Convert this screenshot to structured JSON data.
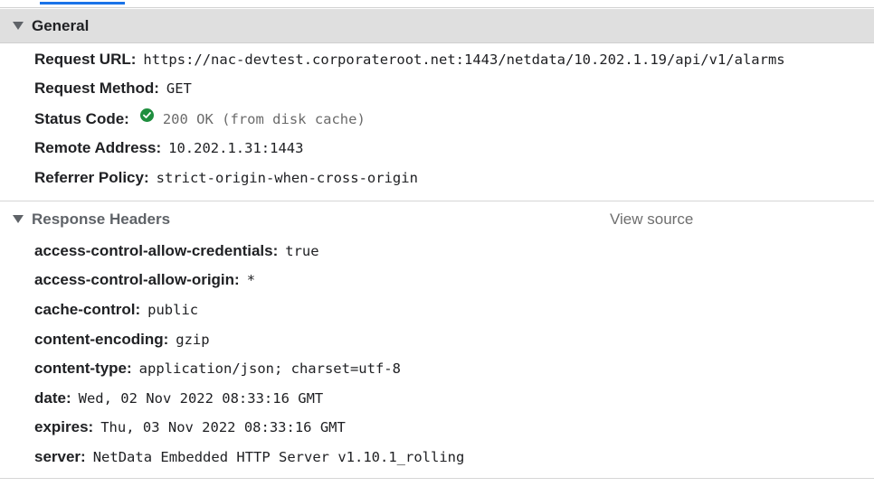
{
  "general": {
    "title": "General",
    "rows": [
      {
        "name": "Request URL:",
        "value": "https://nac-devtest.corporateroot.net:1443/netdata/10.202.1.19/api/v1/alarms"
      },
      {
        "name": "Request Method:",
        "value": "GET"
      },
      {
        "name": "Status Code:",
        "value": "200 OK (from disk cache)"
      },
      {
        "name": "Remote Address:",
        "value": "10.202.1.31:1443"
      },
      {
        "name": "Referrer Policy:",
        "value": "strict-origin-when-cross-origin"
      }
    ]
  },
  "response_headers": {
    "title": "Response Headers",
    "view_source_label": "View source",
    "rows": [
      {
        "name": "access-control-allow-credentials:",
        "value": "true"
      },
      {
        "name": "access-control-allow-origin:",
        "value": "*"
      },
      {
        "name": "cache-control:",
        "value": "public"
      },
      {
        "name": "content-encoding:",
        "value": "gzip"
      },
      {
        "name": "content-type:",
        "value": "application/json; charset=utf-8"
      },
      {
        "name": "date:",
        "value": "Wed, 02 Nov 2022 08:33:16 GMT"
      },
      {
        "name": "expires:",
        "value": "Thu, 03 Nov 2022 08:33:16 GMT"
      },
      {
        "name": "server:",
        "value": "NetData Embedded HTTP Server v1.10.1_rolling"
      }
    ]
  },
  "icons": {
    "section_toggle": "triangle-down-icon",
    "status": "check-circle-icon"
  },
  "colors": {
    "accent": "#1a73e8",
    "status_ok": "#1e8e3e",
    "header_bg": "#dfdfdf"
  }
}
